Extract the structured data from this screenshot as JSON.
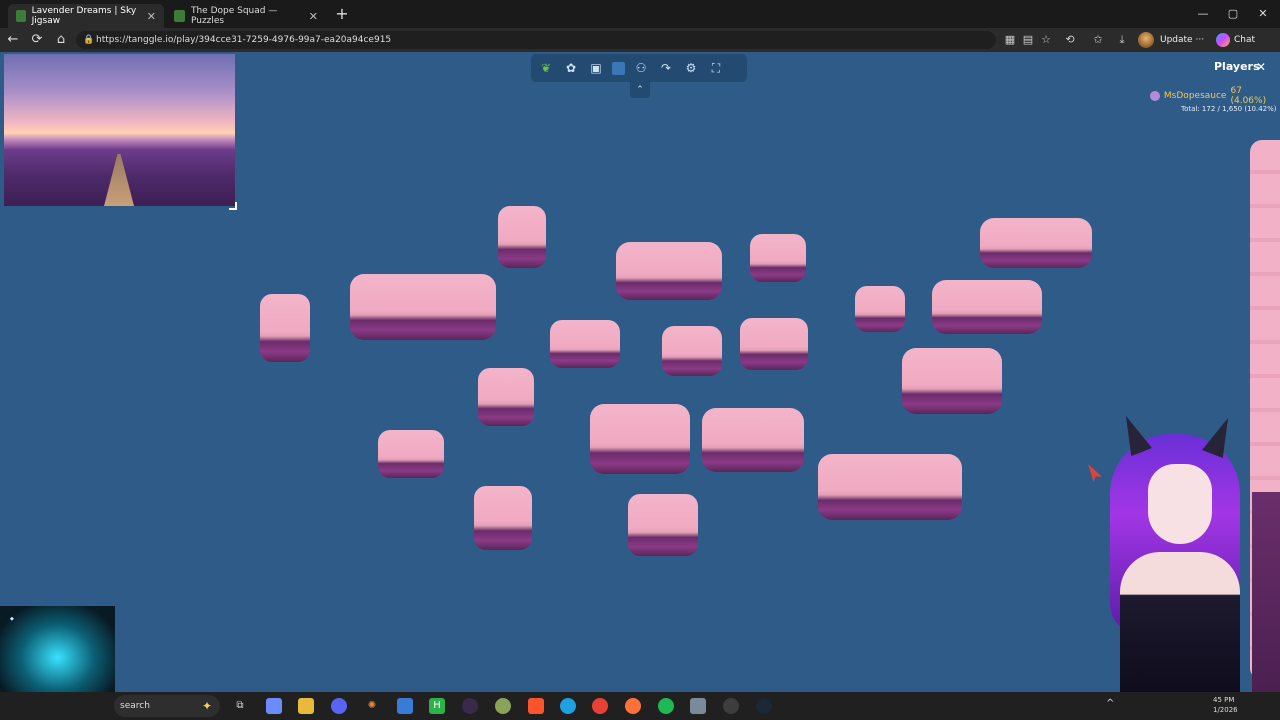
{
  "browser": {
    "tabs": [
      {
        "title": "Lavender Dreams | Sky Jigsaw",
        "active": true
      },
      {
        "title": "The Dope Squad — Puzzles",
        "active": false
      }
    ],
    "new_tab": "+",
    "window_controls": {
      "minimize": "—",
      "maximize": "▢",
      "close": "✕"
    },
    "nav": {
      "back": "←",
      "reload": "⟳",
      "home": "⌂"
    },
    "url": "https://tanggle.io/play/394cce31-7259-4976-99a7-ea20a94ce915",
    "update_label": "Update",
    "update_more": "···",
    "chat_label": "Chat"
  },
  "game": {
    "toolbar_icons": [
      "leaf-icon",
      "pieces-icon",
      "image-icon",
      "square-icon",
      "players-icon",
      "share-icon",
      "settings-icon",
      "fullscreen-icon"
    ],
    "collapse_icon": "⌃",
    "players": {
      "title": "Players",
      "close": "✕",
      "entries": [
        {
          "name": "MsDopesauce",
          "score": "67 (4.06%)"
        }
      ],
      "total": "Total: 172 / 1,650 (10.42%)"
    }
  },
  "taskbar": {
    "search_placeholder": "search",
    "clock_time": "45 PM",
    "clock_date": "1/2026",
    "tray_up": "^"
  }
}
